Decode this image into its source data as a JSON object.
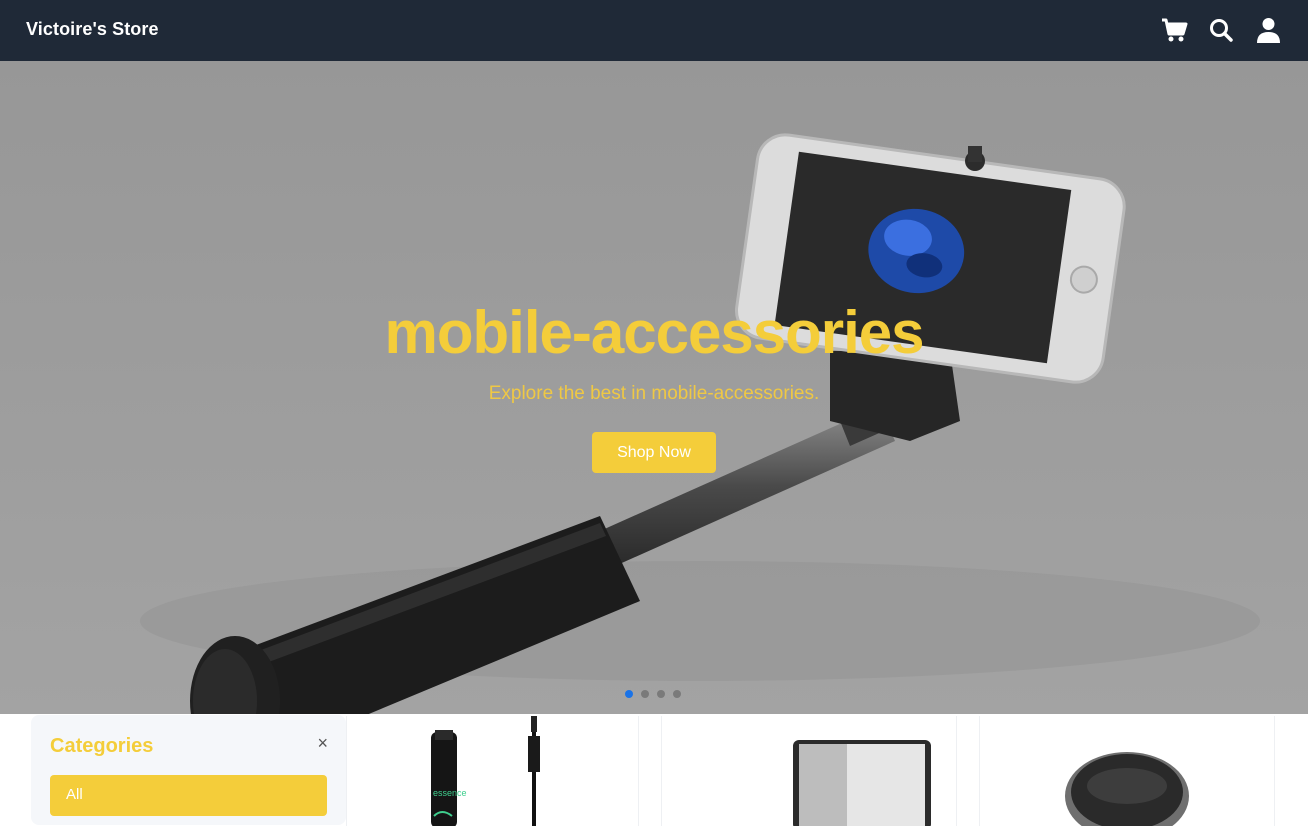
{
  "header": {
    "brand": "Victoire's Store",
    "icons": [
      "cart-icon",
      "search-icon",
      "user-icon"
    ]
  },
  "hero": {
    "title": "mobile-accessories",
    "subtitle": "Explore the best in mobile-accessories.",
    "button_label": "Shop Now",
    "slide_count": 4,
    "active_slide": 1
  },
  "sidebar": {
    "title": "Categories",
    "close_symbol": "×",
    "selected_category": "All"
  },
  "products": [
    {
      "image": "mascara-image"
    },
    {
      "image": "laptop-image"
    },
    {
      "image": "round-device-image"
    }
  ],
  "colors": {
    "header_bg": "#1f2937",
    "accent_yellow": "#f4cd3a",
    "hero_bg": "#9c9c9c",
    "active_dot": "#1a73e8"
  }
}
